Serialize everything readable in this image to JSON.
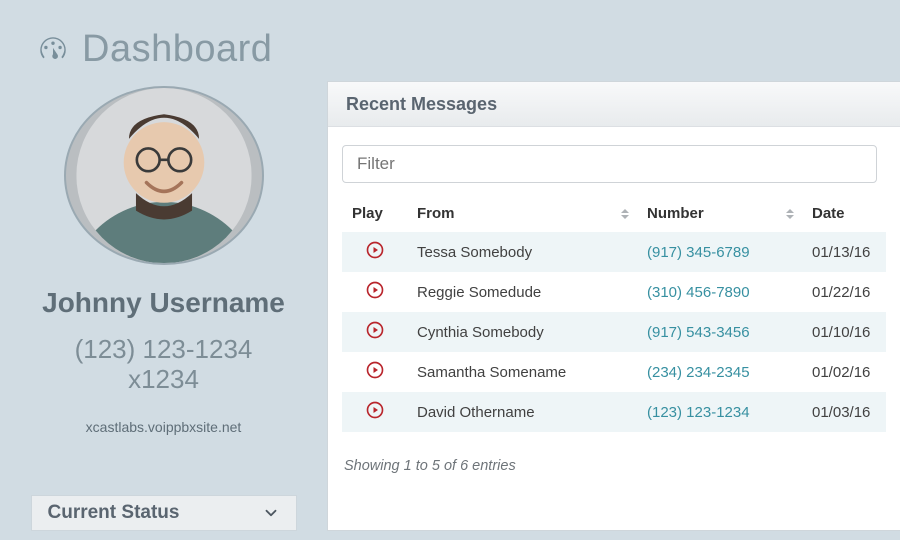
{
  "page_title": "Dashboard",
  "profile": {
    "name": "Johnny Username",
    "phone": "(123) 123-1234",
    "extension": "x1234",
    "domain": "xcastlabs.voippbxsite.net"
  },
  "status": {
    "label": "Current Status"
  },
  "messages": {
    "panel_title": "Recent Messages",
    "filter_placeholder": "Filter",
    "columns": {
      "play": "Play",
      "from": "From",
      "number": "Number",
      "date": "Date"
    },
    "rows": [
      {
        "from": "Tessa Somebody",
        "number": "(917) 345-6789",
        "date": "01/13/16"
      },
      {
        "from": "Reggie Somedude",
        "number": "(310) 456-7890",
        "date": "01/22/16"
      },
      {
        "from": "Cynthia Somebody",
        "number": "(917) 543-3456",
        "date": "01/10/16"
      },
      {
        "from": "Samantha Somename",
        "number": "(234) 234-2345",
        "date": "01/02/16"
      },
      {
        "from": "David Othername",
        "number": "(123) 123-1234",
        "date": "01/03/16"
      }
    ],
    "showing": "Showing 1 to 5 of 6 entries"
  }
}
